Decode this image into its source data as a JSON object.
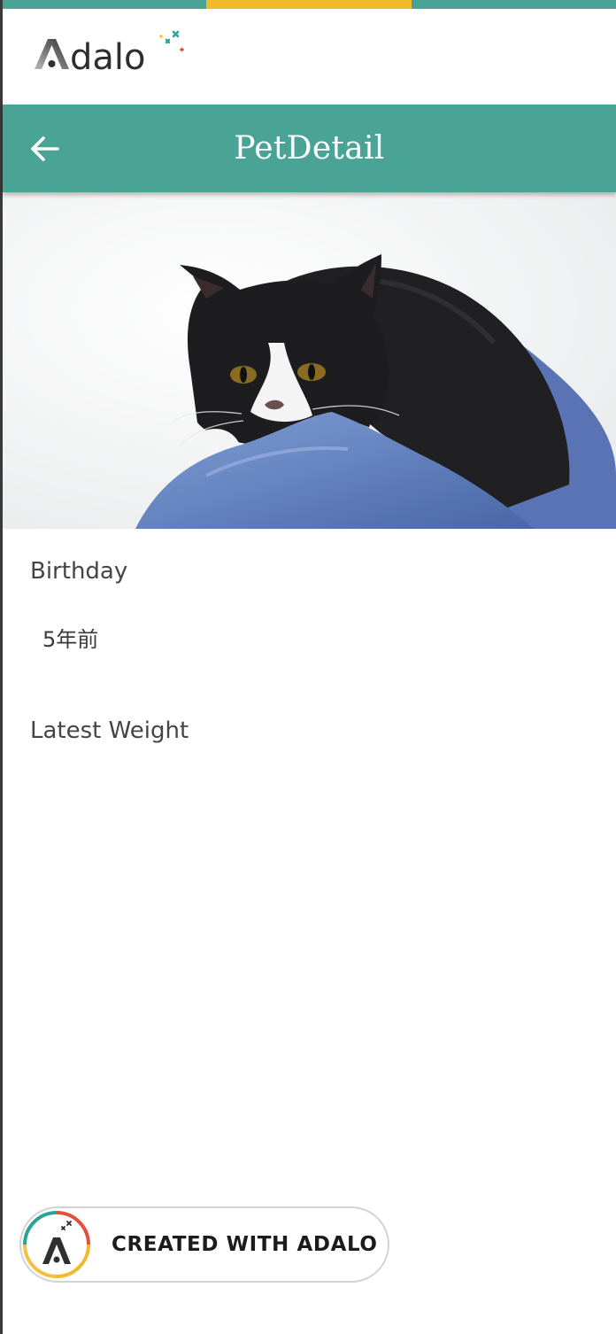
{
  "colors": {
    "stripe_teal": "#4aa496",
    "stripe_yellow": "#f3b92c",
    "nav_background": "#4aa496",
    "nav_text": "#ffffff"
  },
  "brand": {
    "logo_text": "Adalo"
  },
  "nav": {
    "title": "PetDetail",
    "back_icon": "arrow-left-icon"
  },
  "hero": {
    "subject": "cat-photo"
  },
  "fields": [
    {
      "label": "Birthday",
      "value": "5年前"
    },
    {
      "label": "Latest Weight",
      "value": ""
    }
  ],
  "badge": {
    "label": "CREATED WITH ADALO",
    "icon": "adalo-logo-icon"
  }
}
